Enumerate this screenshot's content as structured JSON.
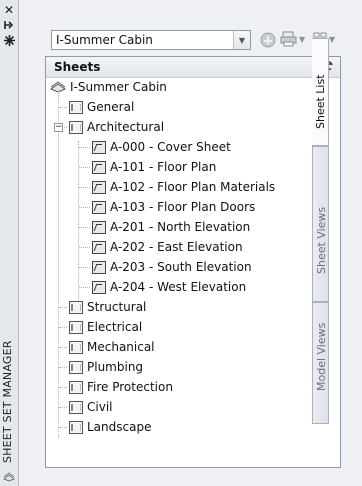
{
  "palette": {
    "title": "SHEET SET MANAGER",
    "icons": [
      "close-icon",
      "autohide-icon",
      "properties-icon",
      "palette-menu-icon"
    ]
  },
  "toolbar": {
    "sheet_set_selector": "I-Summer Cabin",
    "icons": [
      "publish-icon",
      "plot-icon",
      "sheet-selections-icon"
    ]
  },
  "tree": {
    "header": "Sheets",
    "root": "I-Summer Cabin",
    "items": [
      {
        "label": "General",
        "level": 1,
        "type": "subset"
      },
      {
        "label": "Architectural",
        "level": 1,
        "type": "subset",
        "expanded": true
      },
      {
        "label": "A-000 - Cover Sheet",
        "level": 2,
        "type": "sheet"
      },
      {
        "label": "A-101 - Floor Plan",
        "level": 2,
        "type": "sheet"
      },
      {
        "label": "A-102 - Floor Plan Materials",
        "level": 2,
        "type": "sheet"
      },
      {
        "label": "A-103 - Floor Plan Doors",
        "level": 2,
        "type": "sheet"
      },
      {
        "label": "A-201 - North Elevation",
        "level": 2,
        "type": "sheet"
      },
      {
        "label": "A-202 - East Elevation",
        "level": 2,
        "type": "sheet"
      },
      {
        "label": "A-203 - South Elevation",
        "level": 2,
        "type": "sheet"
      },
      {
        "label": "A-204 - West Elevation",
        "level": 2,
        "type": "sheet"
      },
      {
        "label": "Structural",
        "level": 1,
        "type": "subset"
      },
      {
        "label": "Electrical",
        "level": 1,
        "type": "subset"
      },
      {
        "label": "Mechanical",
        "level": 1,
        "type": "subset"
      },
      {
        "label": "Plumbing",
        "level": 1,
        "type": "subset"
      },
      {
        "label": "Fire Protection",
        "level": 1,
        "type": "subset"
      },
      {
        "label": "Civil",
        "level": 1,
        "type": "subset"
      },
      {
        "label": "Landscape",
        "level": 1,
        "type": "subset"
      }
    ]
  },
  "tabs": [
    "Sheet List",
    "Sheet Views",
    "Model Views"
  ],
  "active_tab": "Sheet List"
}
